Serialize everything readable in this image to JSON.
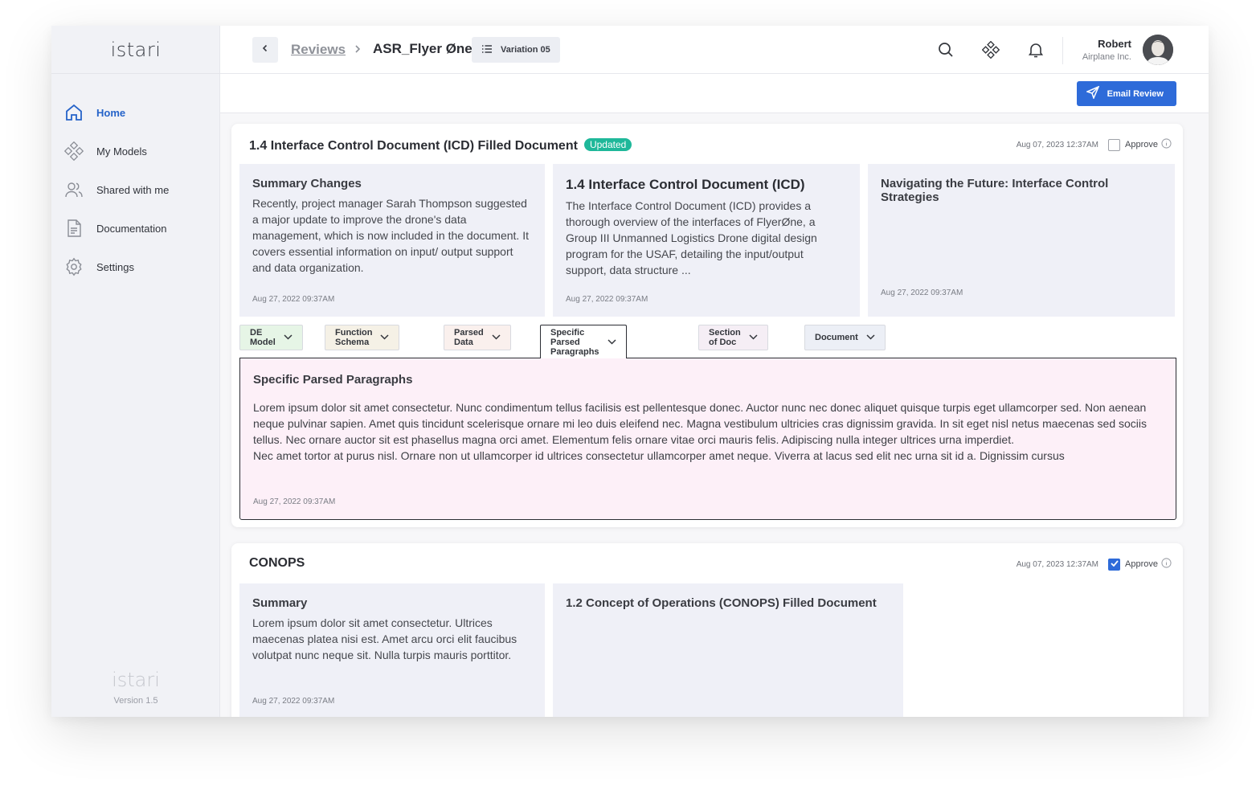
{
  "app": {
    "logo": "istari",
    "version": "Version 1.5"
  },
  "sidebar": {
    "items": [
      {
        "label": "Home",
        "icon": "home-icon"
      },
      {
        "label": "My Models",
        "icon": "models-icon"
      },
      {
        "label": "Shared with me",
        "icon": "users-icon"
      },
      {
        "label": "Documentation",
        "icon": "document-icon"
      },
      {
        "label": "Settings",
        "icon": "gear-icon"
      }
    ]
  },
  "header": {
    "breadcrumb_parent": "Reviews",
    "breadcrumb_current": "ASR_Flyer Øne",
    "variation": "Variation 05",
    "user": {
      "name": "Robert",
      "org": "Airplane Inc."
    }
  },
  "toolbar": {
    "email_review_label": "Email Review"
  },
  "colors": {
    "accent": "#2e6bd9",
    "updated_badge": "#1fb89a",
    "active_nav": "#2563c9"
  },
  "sections": [
    {
      "title": "1.4 Interface Control Document (ICD) Filled Document",
      "badge": "Updated",
      "timestamp": "Aug 07, 2023 12:37AM",
      "approve_label": "Approve",
      "approved": false,
      "cards": [
        {
          "heading": "Summary Changes",
          "body": "Recently, project manager Sarah Thompson suggested a major update to improve the drone's data management, which is now included in the document. It covers essential information on input/ output support and data organization.",
          "timestamp": "Aug 27, 2022 09:37AM"
        },
        {
          "heading": "1.4 Interface Control Document (ICD)",
          "body": "The Interface Control Document (ICD) provides a thorough overview of the interfaces of FlyerØne, a Group III Unmanned Logistics Drone digital design program for the USAF, detailing the input/output support, data structure ...",
          "timestamp": "Aug 27, 2022 09:37AM"
        },
        {
          "heading": "Navigating the Future: Interface Control Strategies",
          "body": "",
          "timestamp": "Aug 27, 2022 09:37AM"
        }
      ],
      "tabs": [
        {
          "label": "DE Model",
          "bg": "#e6f5e6"
        },
        {
          "label": "Function Schema",
          "bg": "#f5f1e6"
        },
        {
          "label": "Parsed Data",
          "bg": "#faf0ed"
        },
        {
          "label": "Specific Parsed Paragraphs",
          "bg": "#ffffff"
        },
        {
          "label": "Section of Doc",
          "bg": "#f5eef5"
        },
        {
          "label": "Document",
          "bg": "#eceff6"
        }
      ],
      "active_tab": {
        "title": "Specific Parsed Paragraphs",
        "para1": "Lorem ipsum dolor sit amet consectetur. Nunc condimentum tellus facilisis est pellentesque donec. Auctor nunc nec donec aliquet quisque turpis eget ullamcorper sed. Non aenean neque pulvinar sapien. Amet quis tincidunt scelerisque ornare mi leo duis eleifend nec. Magna vestibulum ultricies cras dignissim gravida. In sit eget nisl netus maecenas sed sociis tellus. Nec ornare auctor sit est phasellus magna orci amet. Elementum felis ornare vitae orci mauris felis. Adipiscing nulla integer ultrices urna imperdiet.",
        "para2": "Nec amet tortor at purus nisl. Ornare non ut ullamcorper id ultrices consectetur ullamcorper amet neque. Viverra at lacus sed elit nec urna sit id a. Dignissim cursus",
        "timestamp": "Aug 27, 2022 09:37AM"
      }
    },
    {
      "title": "CONOPS",
      "timestamp": "Aug 07, 2023 12:37AM",
      "approve_label": "Approve",
      "approved": true,
      "cards": [
        {
          "heading": "Summary",
          "body": "Lorem ipsum dolor sit amet consectetur. Ultrices maecenas platea nisi est. Amet arcu orci elit faucibus volutpat nunc neque sit. Nulla turpis mauris porttitor.",
          "timestamp": "Aug 27, 2022 09:37AM"
        },
        {
          "heading": "1.2 Concept of Operations (CONOPS) Filled Document",
          "body": ""
        }
      ]
    }
  ]
}
